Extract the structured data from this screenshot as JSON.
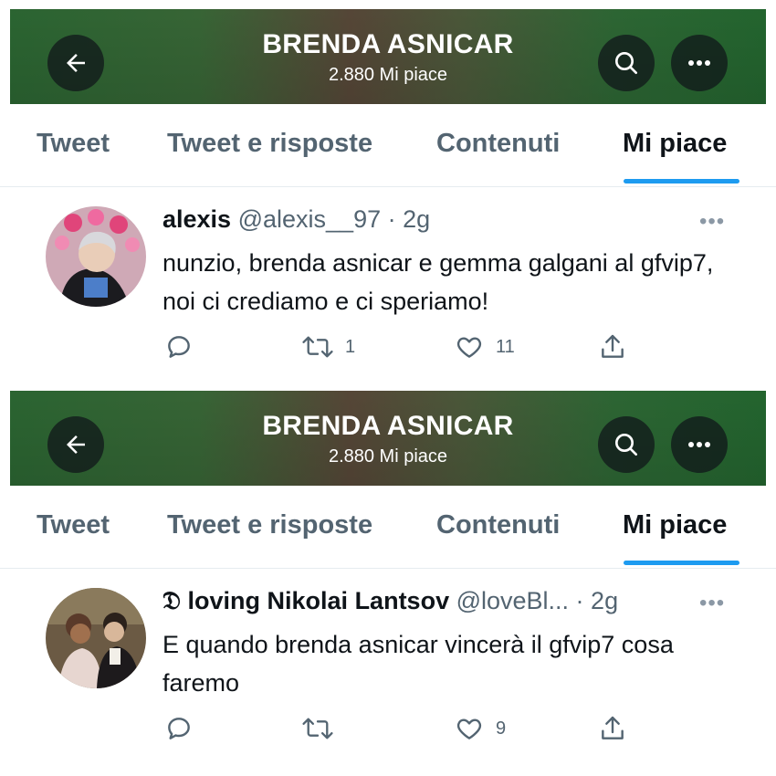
{
  "panels": [
    {
      "profile": {
        "name": "BRENDA ASNICAR",
        "likes": "2.880 Mi piace"
      },
      "tabs": [
        "Tweet",
        "Tweet e risposte",
        "Contenuti",
        "Mi piace"
      ],
      "active_tab": "Mi piace",
      "tweet": {
        "name": "alexis",
        "handle": "@alexis__97 · 2g",
        "text": "nunzio, brenda asnicar e gemma galgani al gfvip7, noi ci crediamo e ci speriamo!",
        "retweets": "1",
        "likes": "11"
      }
    },
    {
      "profile": {
        "name": "BRENDA ASNICAR",
        "likes": "2.880 Mi piace"
      },
      "tabs": [
        "Tweet",
        "Tweet e risposte",
        "Contenuti",
        "Mi piace"
      ],
      "active_tab": "Mi piace",
      "tweet": {
        "name": "𝔇 loving Nikolai Lantsov",
        "handle": "@loveBl... · 2g",
        "text": "E quando brenda asnicar vincerà il gfvip7 cosa faremo",
        "retweets": "",
        "likes": "9"
      }
    }
  ],
  "colors": {
    "accent": "#1d9bf0",
    "banner": "#2d6a34",
    "muted": "#536471"
  },
  "icons": [
    "back-arrow-icon",
    "search-icon",
    "more-icon",
    "reply-icon",
    "retweet-icon",
    "like-icon",
    "share-icon"
  ]
}
